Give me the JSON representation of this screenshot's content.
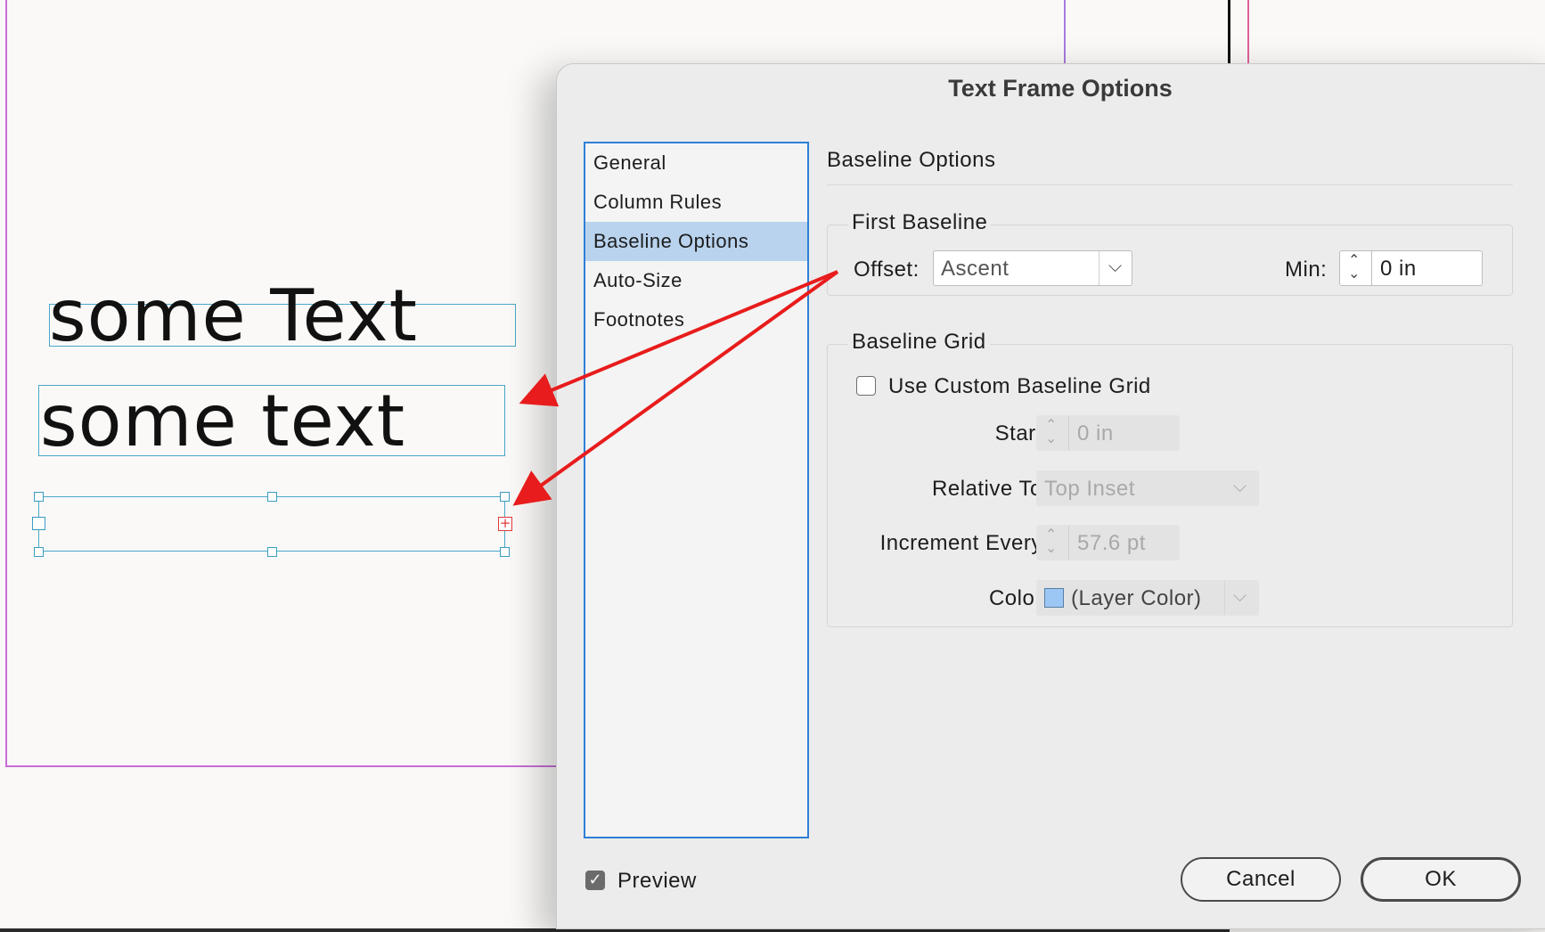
{
  "canvas": {
    "frames": [
      {
        "text": "some Text"
      },
      {
        "text": "some text"
      },
      {
        "text": ""
      }
    ],
    "overset_symbol": "+"
  },
  "dialog": {
    "title": "Text Frame Options",
    "sidebar": {
      "items": [
        {
          "label": "General",
          "selected": false
        },
        {
          "label": "Column Rules",
          "selected": false
        },
        {
          "label": "Baseline Options",
          "selected": true
        },
        {
          "label": "Auto-Size",
          "selected": false
        },
        {
          "label": "Footnotes",
          "selected": false
        }
      ]
    },
    "panel": {
      "heading": "Baseline Options",
      "first_baseline": {
        "title": "First Baseline",
        "offset_label": "Offset:",
        "offset_value": "Ascent",
        "min_label": "Min:",
        "min_value": "0 in"
      },
      "baseline_grid": {
        "title": "Baseline Grid",
        "use_custom_label": "Use Custom Baseline Grid",
        "use_custom_checked": false,
        "start_label": "Start:",
        "start_value": "0 in",
        "relative_to_label": "Relative To:",
        "relative_to_value": "Top Inset",
        "increment_label": "Increment Every:",
        "increment_value": "57.6 pt",
        "color_label": "Color:",
        "color_value": "(Layer Color)",
        "color_swatch": "#9cc7f4"
      }
    },
    "preview": {
      "label": "Preview",
      "checked": true,
      "check_glyph": "✓"
    },
    "buttons": {
      "cancel": "Cancel",
      "ok": "OK"
    }
  },
  "colors": {
    "arrow": "#e81c1c",
    "frame": "#4aa8c9",
    "selection": "#b9d3ee",
    "margin_guide": "#c86dd6"
  }
}
